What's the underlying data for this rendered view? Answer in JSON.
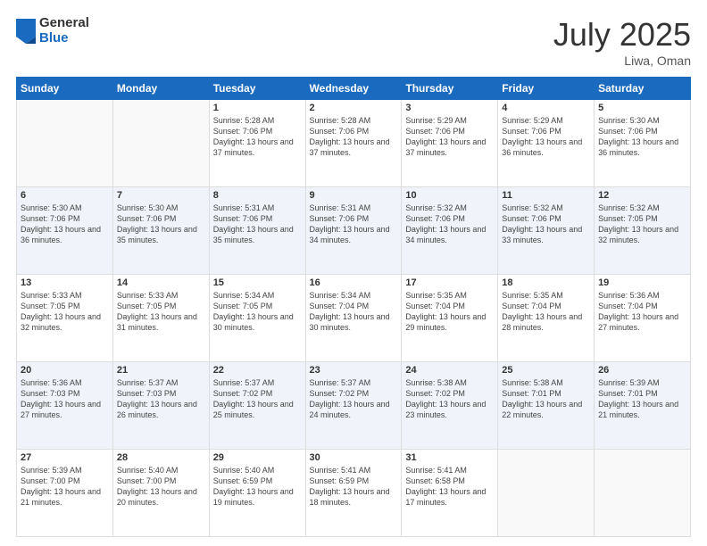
{
  "logo": {
    "general": "General",
    "blue": "Blue"
  },
  "header": {
    "month": "July 2025",
    "location": "Liwa, Oman"
  },
  "weekdays": [
    "Sunday",
    "Monday",
    "Tuesday",
    "Wednesday",
    "Thursday",
    "Friday",
    "Saturday"
  ],
  "weeks": [
    [
      {
        "day": "",
        "sunrise": "",
        "sunset": "",
        "daylight": ""
      },
      {
        "day": "",
        "sunrise": "",
        "sunset": "",
        "daylight": ""
      },
      {
        "day": "1",
        "sunrise": "Sunrise: 5:28 AM",
        "sunset": "Sunset: 7:06 PM",
        "daylight": "Daylight: 13 hours and 37 minutes."
      },
      {
        "day": "2",
        "sunrise": "Sunrise: 5:28 AM",
        "sunset": "Sunset: 7:06 PM",
        "daylight": "Daylight: 13 hours and 37 minutes."
      },
      {
        "day": "3",
        "sunrise": "Sunrise: 5:29 AM",
        "sunset": "Sunset: 7:06 PM",
        "daylight": "Daylight: 13 hours and 37 minutes."
      },
      {
        "day": "4",
        "sunrise": "Sunrise: 5:29 AM",
        "sunset": "Sunset: 7:06 PM",
        "daylight": "Daylight: 13 hours and 36 minutes."
      },
      {
        "day": "5",
        "sunrise": "Sunrise: 5:30 AM",
        "sunset": "Sunset: 7:06 PM",
        "daylight": "Daylight: 13 hours and 36 minutes."
      }
    ],
    [
      {
        "day": "6",
        "sunrise": "Sunrise: 5:30 AM",
        "sunset": "Sunset: 7:06 PM",
        "daylight": "Daylight: 13 hours and 36 minutes."
      },
      {
        "day": "7",
        "sunrise": "Sunrise: 5:30 AM",
        "sunset": "Sunset: 7:06 PM",
        "daylight": "Daylight: 13 hours and 35 minutes."
      },
      {
        "day": "8",
        "sunrise": "Sunrise: 5:31 AM",
        "sunset": "Sunset: 7:06 PM",
        "daylight": "Daylight: 13 hours and 35 minutes."
      },
      {
        "day": "9",
        "sunrise": "Sunrise: 5:31 AM",
        "sunset": "Sunset: 7:06 PM",
        "daylight": "Daylight: 13 hours and 34 minutes."
      },
      {
        "day": "10",
        "sunrise": "Sunrise: 5:32 AM",
        "sunset": "Sunset: 7:06 PM",
        "daylight": "Daylight: 13 hours and 34 minutes."
      },
      {
        "day": "11",
        "sunrise": "Sunrise: 5:32 AM",
        "sunset": "Sunset: 7:06 PM",
        "daylight": "Daylight: 13 hours and 33 minutes."
      },
      {
        "day": "12",
        "sunrise": "Sunrise: 5:32 AM",
        "sunset": "Sunset: 7:05 PM",
        "daylight": "Daylight: 13 hours and 32 minutes."
      }
    ],
    [
      {
        "day": "13",
        "sunrise": "Sunrise: 5:33 AM",
        "sunset": "Sunset: 7:05 PM",
        "daylight": "Daylight: 13 hours and 32 minutes."
      },
      {
        "day": "14",
        "sunrise": "Sunrise: 5:33 AM",
        "sunset": "Sunset: 7:05 PM",
        "daylight": "Daylight: 13 hours and 31 minutes."
      },
      {
        "day": "15",
        "sunrise": "Sunrise: 5:34 AM",
        "sunset": "Sunset: 7:05 PM",
        "daylight": "Daylight: 13 hours and 30 minutes."
      },
      {
        "day": "16",
        "sunrise": "Sunrise: 5:34 AM",
        "sunset": "Sunset: 7:04 PM",
        "daylight": "Daylight: 13 hours and 30 minutes."
      },
      {
        "day": "17",
        "sunrise": "Sunrise: 5:35 AM",
        "sunset": "Sunset: 7:04 PM",
        "daylight": "Daylight: 13 hours and 29 minutes."
      },
      {
        "day": "18",
        "sunrise": "Sunrise: 5:35 AM",
        "sunset": "Sunset: 7:04 PM",
        "daylight": "Daylight: 13 hours and 28 minutes."
      },
      {
        "day": "19",
        "sunrise": "Sunrise: 5:36 AM",
        "sunset": "Sunset: 7:04 PM",
        "daylight": "Daylight: 13 hours and 27 minutes."
      }
    ],
    [
      {
        "day": "20",
        "sunrise": "Sunrise: 5:36 AM",
        "sunset": "Sunset: 7:03 PM",
        "daylight": "Daylight: 13 hours and 27 minutes."
      },
      {
        "day": "21",
        "sunrise": "Sunrise: 5:37 AM",
        "sunset": "Sunset: 7:03 PM",
        "daylight": "Daylight: 13 hours and 26 minutes."
      },
      {
        "day": "22",
        "sunrise": "Sunrise: 5:37 AM",
        "sunset": "Sunset: 7:02 PM",
        "daylight": "Daylight: 13 hours and 25 minutes."
      },
      {
        "day": "23",
        "sunrise": "Sunrise: 5:37 AM",
        "sunset": "Sunset: 7:02 PM",
        "daylight": "Daylight: 13 hours and 24 minutes."
      },
      {
        "day": "24",
        "sunrise": "Sunrise: 5:38 AM",
        "sunset": "Sunset: 7:02 PM",
        "daylight": "Daylight: 13 hours and 23 minutes."
      },
      {
        "day": "25",
        "sunrise": "Sunrise: 5:38 AM",
        "sunset": "Sunset: 7:01 PM",
        "daylight": "Daylight: 13 hours and 22 minutes."
      },
      {
        "day": "26",
        "sunrise": "Sunrise: 5:39 AM",
        "sunset": "Sunset: 7:01 PM",
        "daylight": "Daylight: 13 hours and 21 minutes."
      }
    ],
    [
      {
        "day": "27",
        "sunrise": "Sunrise: 5:39 AM",
        "sunset": "Sunset: 7:00 PM",
        "daylight": "Daylight: 13 hours and 21 minutes."
      },
      {
        "day": "28",
        "sunrise": "Sunrise: 5:40 AM",
        "sunset": "Sunset: 7:00 PM",
        "daylight": "Daylight: 13 hours and 20 minutes."
      },
      {
        "day": "29",
        "sunrise": "Sunrise: 5:40 AM",
        "sunset": "Sunset: 6:59 PM",
        "daylight": "Daylight: 13 hours and 19 minutes."
      },
      {
        "day": "30",
        "sunrise": "Sunrise: 5:41 AM",
        "sunset": "Sunset: 6:59 PM",
        "daylight": "Daylight: 13 hours and 18 minutes."
      },
      {
        "day": "31",
        "sunrise": "Sunrise: 5:41 AM",
        "sunset": "Sunset: 6:58 PM",
        "daylight": "Daylight: 13 hours and 17 minutes."
      },
      {
        "day": "",
        "sunrise": "",
        "sunset": "",
        "daylight": ""
      },
      {
        "day": "",
        "sunrise": "",
        "sunset": "",
        "daylight": ""
      }
    ]
  ]
}
